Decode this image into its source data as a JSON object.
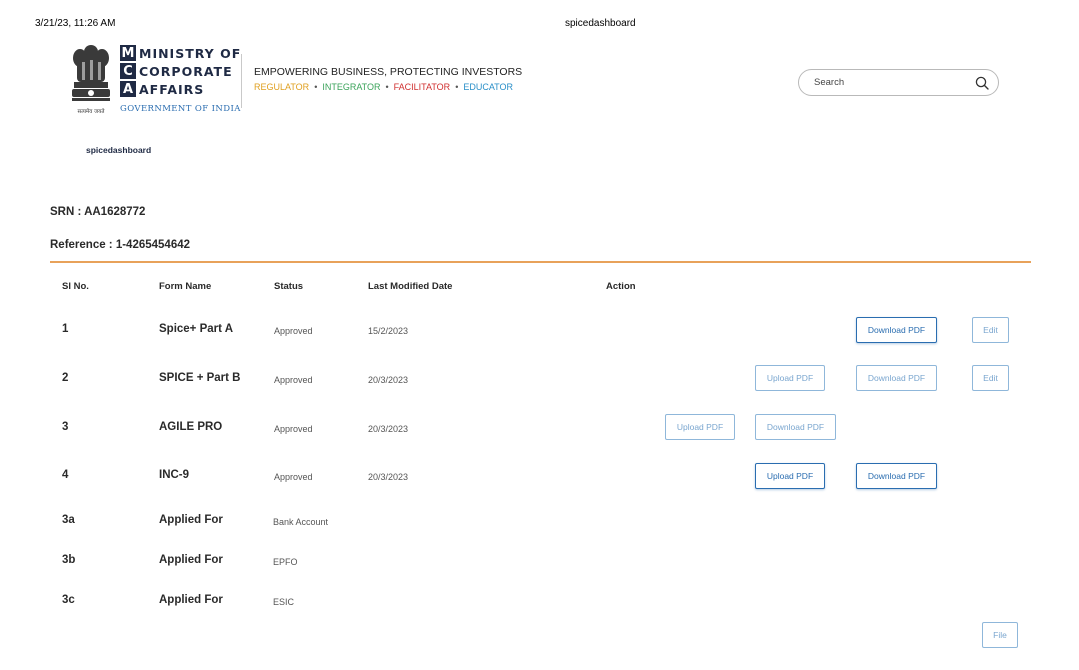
{
  "print_header": {
    "timestamp": "3/21/23, 11:26 AM",
    "page_title": "spicedashboard"
  },
  "brand": {
    "letters": [
      "M",
      "C",
      "A"
    ],
    "words": [
      "MINISTRY OF",
      "CORPORATE",
      "AFFAIRS"
    ],
    "government": "GOVERNMENT OF INDIA",
    "emblem_caption": "सत्यमेव जयते",
    "tagline": "EMPOWERING BUSINESS, PROTECTING INVESTORS",
    "roles": [
      {
        "label": "REGULATOR",
        "color": "#e0a020"
      },
      {
        "label": "INTEGRATOR",
        "color": "#3aa35a"
      },
      {
        "label": "FACILITATOR",
        "color": "#d03030"
      },
      {
        "label": "EDUCATOR",
        "color": "#2a8fc8"
      }
    ]
  },
  "search": {
    "placeholder": "Search",
    "value": ""
  },
  "breadcrumb": "spicedashboard",
  "srn": "SRN : AA1628772",
  "reference": "Reference : 1-4265454642",
  "table": {
    "headers": [
      "Sl No.",
      "Form Name",
      "Status",
      "Last Modified Date",
      "Action"
    ],
    "rows": [
      {
        "sl": "1",
        "form": "Spice+ Part A",
        "status": "Approved",
        "date": "15/2/2023"
      },
      {
        "sl": "2",
        "form": "SPICE + Part B",
        "status": "Approved",
        "date": "20/3/2023"
      },
      {
        "sl": "3",
        "form": "AGILE PRO",
        "status": "Approved",
        "date": "20/3/2023"
      },
      {
        "sl": "4",
        "form": "INC-9",
        "status": "Approved",
        "date": "20/3/2023"
      },
      {
        "sl": "3a",
        "form": "Applied For",
        "status": "Bank Account"
      },
      {
        "sl": "3b",
        "form": "Applied For",
        "status": "EPFO"
      },
      {
        "sl": "3c",
        "form": "Applied For",
        "status": "ESIC"
      }
    ]
  },
  "actions": {
    "upload": "Upload PDF",
    "download": "Download PDF",
    "edit": "Edit",
    "file": "File"
  }
}
